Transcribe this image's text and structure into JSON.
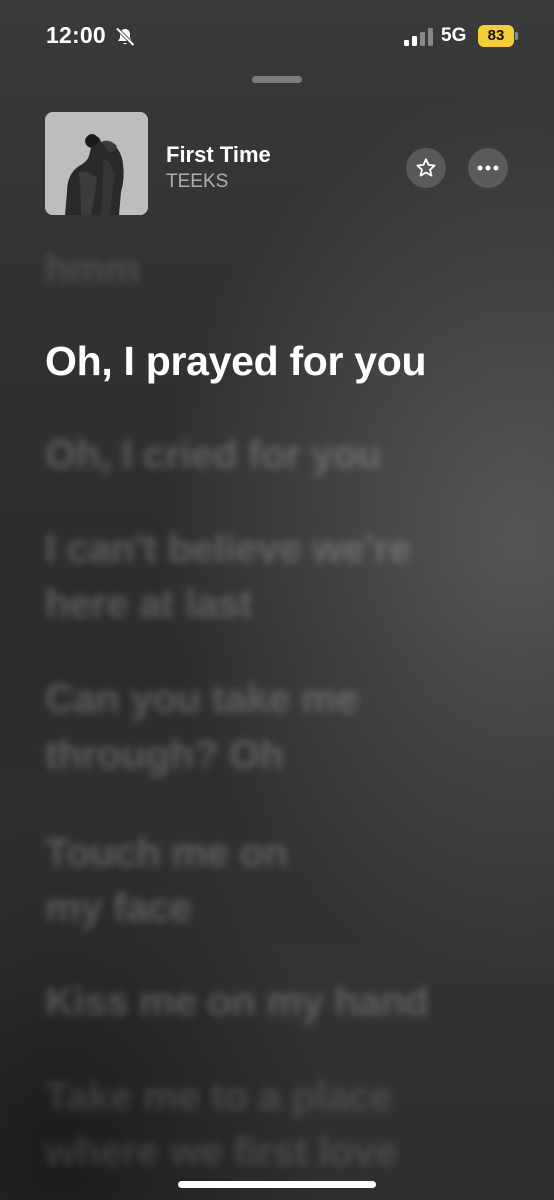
{
  "status_bar": {
    "time": "12:00",
    "network": "5G",
    "battery": "83",
    "battery_color": "#f3cc38"
  },
  "now_playing": {
    "title": "First Time",
    "artist": "TEEKS"
  },
  "lyrics": {
    "previous": "hmm",
    "current": "Oh, I prayed for you",
    "upcoming": [
      "Oh, I cried for you",
      "I can't believe we're",
      "here at last",
      "Can you take me",
      "through? Oh",
      "Touch me on",
      "my face",
      "Kiss me on my hand",
      "Take me to a place",
      "where we first love"
    ]
  },
  "icons": {
    "mute": "bell-slash-icon",
    "signal": "cellular-signal-icon",
    "favorite": "star-icon",
    "more": "ellipsis-icon"
  }
}
